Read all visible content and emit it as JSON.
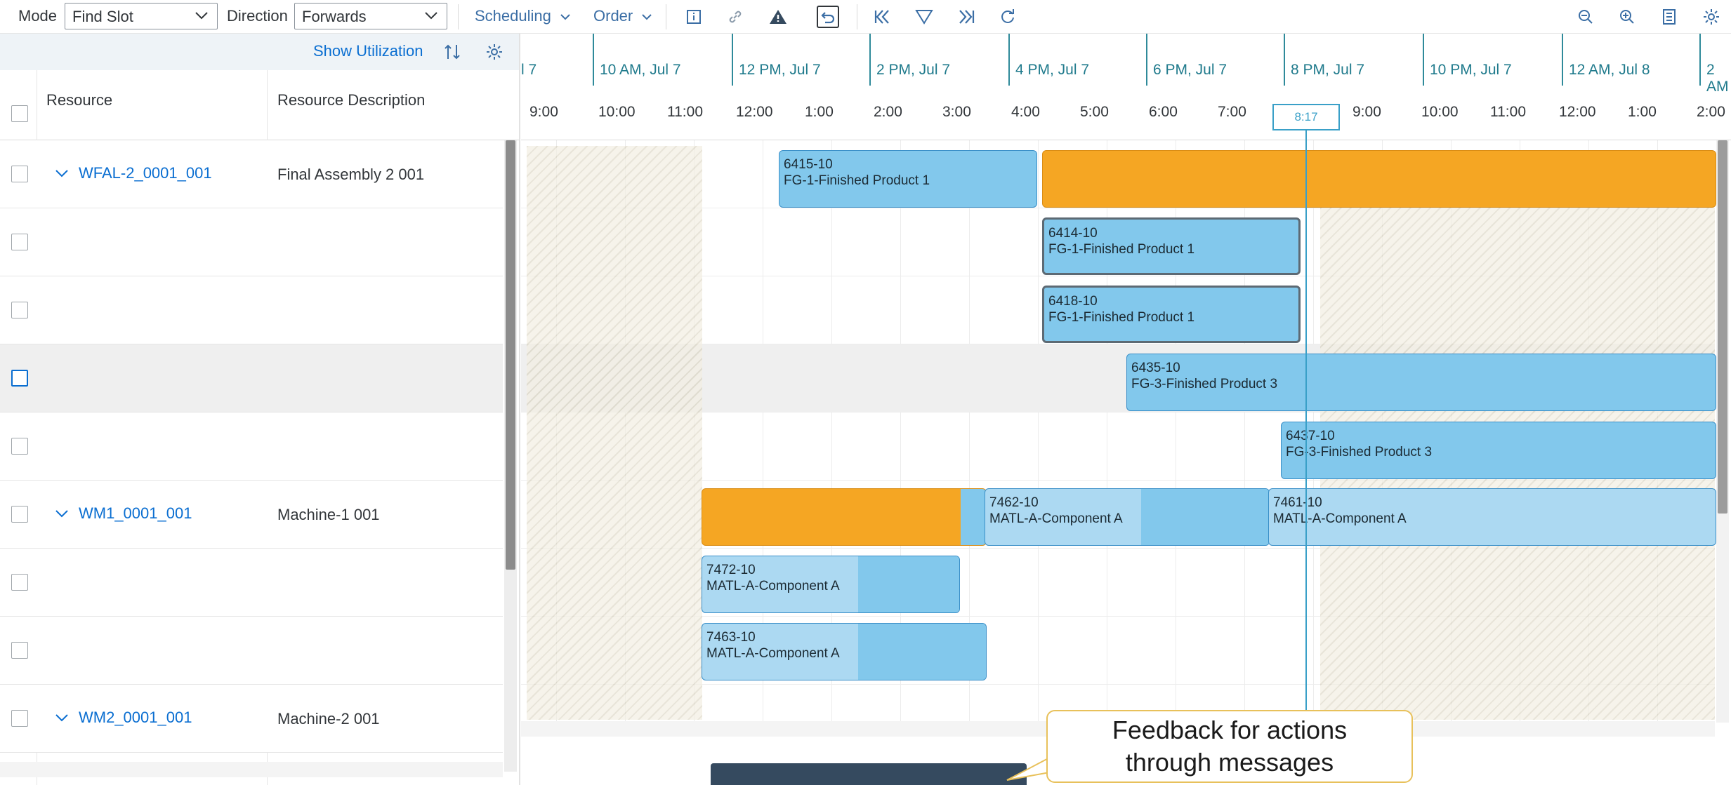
{
  "toolbar": {
    "mode_label": "Mode",
    "mode_value": "Find Slot",
    "direction_label": "Direction",
    "direction_value": "Forwards",
    "scheduling_label": "Scheduling",
    "order_label": "Order"
  },
  "left_panel": {
    "show_utilization": "Show Utilization",
    "columns": [
      "Resource",
      "Resource Description"
    ],
    "rows": [
      {
        "resource": "WFAL-2_0001_001",
        "description": "Final Assembly 2 001",
        "expandable": true
      },
      {
        "resource": "",
        "description": "",
        "expandable": false
      },
      {
        "resource": "",
        "description": "",
        "expandable": false
      },
      {
        "resource": "",
        "description": "",
        "expandable": false,
        "selected": true
      },
      {
        "resource": "",
        "description": "",
        "expandable": false
      },
      {
        "resource": "WM1_0001_001",
        "description": "Machine-1 001",
        "expandable": true
      },
      {
        "resource": "",
        "description": "",
        "expandable": false
      },
      {
        "resource": "",
        "description": "",
        "expandable": false
      },
      {
        "resource": "WM2_0001_001",
        "description": "Machine-2 001",
        "expandable": true
      }
    ]
  },
  "gantt": {
    "days": [
      "l 7",
      "10 AM, Jul 7",
      "12 PM, Jul 7",
      "2 PM, Jul 7",
      "4 PM, Jul 7",
      "6 PM, Jul 7",
      "8 PM, Jul 7",
      "10 PM, Jul 7",
      "12 AM, Jul 8",
      "2 AM"
    ],
    "hours": [
      "9:00",
      "10:00",
      "11:00",
      "12:00",
      "1:00",
      "2:00",
      "3:00",
      "4:00",
      "5:00",
      "6:00",
      "7:00",
      "9:00",
      "10:00",
      "11:00",
      "12:00",
      "1:00",
      "2:00"
    ],
    "current_time": "8:17",
    "bars": [
      {
        "id": "6415-10",
        "product": "FG-1-Finished Product 1"
      },
      {
        "id": "6414-10",
        "product": "FG-1-Finished Product 1"
      },
      {
        "id": "6418-10",
        "product": "FG-1-Finished Product 1"
      },
      {
        "id": "6435-10",
        "product": "FG-3-Finished Product 3"
      },
      {
        "id": "6437-10",
        "product": "FG-3-Finished Product 3"
      },
      {
        "id": "7462-10",
        "product": "MATL-A-Component A"
      },
      {
        "id": "7461-10",
        "product": "MATL-A-Component A"
      },
      {
        "id": "7472-10",
        "product": "MATL-A-Component A"
      },
      {
        "id": "7463-10",
        "product": "MATL-A-Component A"
      }
    ]
  },
  "callout": {
    "line1": "Feedback for actions",
    "line2": "through messages"
  },
  "colors": {
    "accent": "#0a6ed1",
    "bar_blue": "#82c8ec",
    "bar_orange": "#f5a623",
    "toast": "#354a5f"
  }
}
